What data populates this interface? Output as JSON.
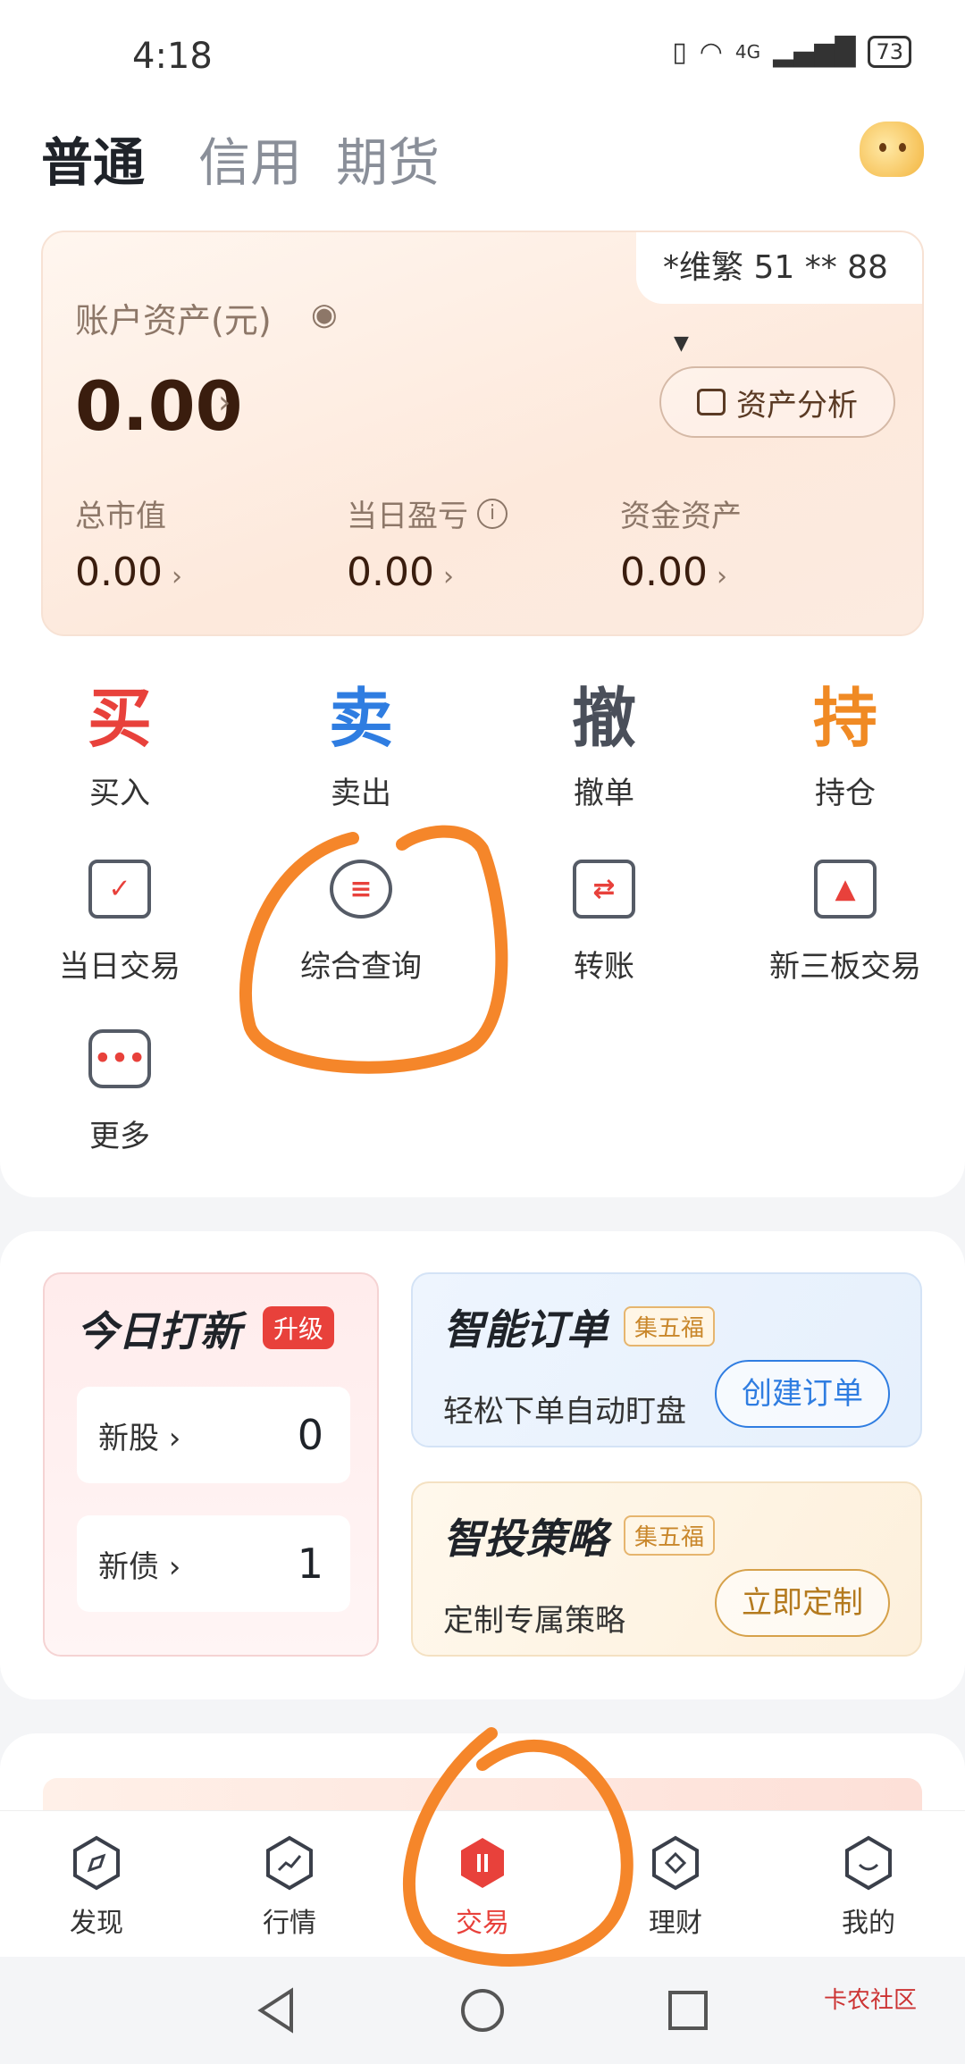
{
  "status": {
    "time": "4:18",
    "network": "4G",
    "battery": "73"
  },
  "account_tabs": [
    "普通",
    "信用",
    "期货"
  ],
  "asset_card": {
    "account": "*维繁 51 ** 88",
    "label": "账户资产(元)",
    "value": "0.00",
    "analysis_button": "资产分析",
    "stats": [
      {
        "label": "总市值",
        "value": "0.00"
      },
      {
        "label": "当日盈亏",
        "value": "0.00"
      },
      {
        "label": "资金资产",
        "value": "0.00"
      }
    ]
  },
  "quick_actions": [
    {
      "glyph": "买",
      "label": "买入",
      "color": "#e8413b"
    },
    {
      "glyph": "卖",
      "label": "卖出",
      "color": "#2f7de1"
    },
    {
      "glyph": "撤",
      "label": "撤单",
      "color": "#4a4f5a"
    },
    {
      "glyph": "持",
      "label": "持仓",
      "color": "#f08a24"
    }
  ],
  "tools": [
    {
      "label": "当日交易",
      "icon": "calendar-check-icon"
    },
    {
      "label": "综合查询",
      "icon": "search-query-icon"
    },
    {
      "label": "转账",
      "icon": "transfer-card-icon"
    },
    {
      "label": "新三板交易",
      "icon": "monitor-triangle-icon"
    },
    {
      "label": "更多",
      "icon": "more-hexagon-icon"
    }
  ],
  "new_ipo": {
    "title": "今日打新",
    "badge": "升级",
    "rows": [
      {
        "label": "新股",
        "count": "0"
      },
      {
        "label": "新债",
        "count": "1"
      }
    ]
  },
  "smart_order": {
    "title": "智能订单",
    "badge": "集五福",
    "subtitle": "轻松下单自动盯盘",
    "button": "创建订单"
  },
  "smart_strategy": {
    "title": "智投策略",
    "badge": "集五福",
    "subtitle": "定制专属策略",
    "button": "立即定制"
  },
  "bottom_nav": [
    "发现",
    "行情",
    "交易",
    "理财",
    "我的"
  ],
  "watermark": "卡农社区",
  "colors": {
    "accent": "#e8413b",
    "blue": "#2f7de1",
    "annotation": "#f5862a"
  }
}
